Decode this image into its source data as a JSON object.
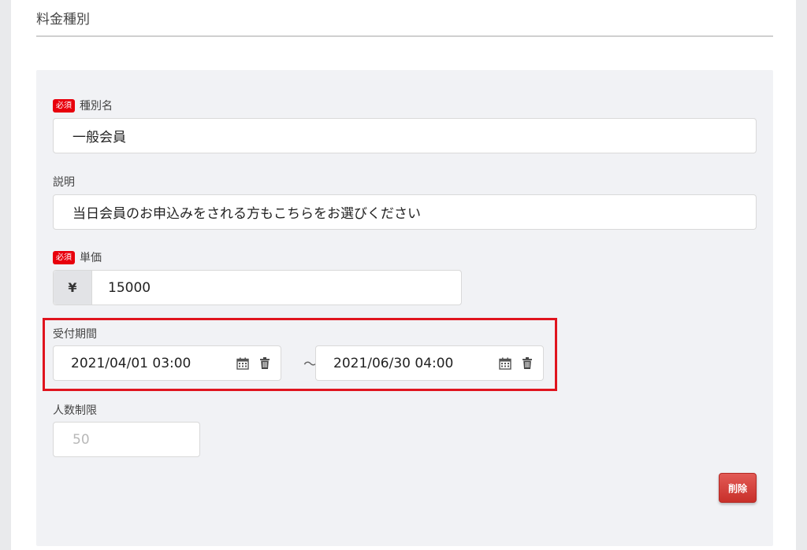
{
  "section": {
    "title": "料金種別"
  },
  "badges": {
    "required": "必須"
  },
  "fields": {
    "type_name": {
      "label": "種別名",
      "value": "一般会員"
    },
    "description": {
      "label": "説明",
      "value": "当日会員のお申込みをされる方もこちらをお選びください"
    },
    "unit_price": {
      "label": "単価",
      "currency_symbol": "¥",
      "value": "15000"
    },
    "reception_period": {
      "label": "受付期間",
      "start": "2021/04/01 03:00",
      "separator": "～",
      "end": "2021/06/30 04:00",
      "icons": [
        "calendar-icon",
        "trash-icon"
      ]
    },
    "capacity": {
      "label": "人数制限",
      "placeholder": "50"
    }
  },
  "buttons": {
    "delete": "削除"
  },
  "colors": {
    "required_badge": "#e8000c",
    "highlight_border": "#e0141e",
    "delete_button": "#d9433e"
  }
}
